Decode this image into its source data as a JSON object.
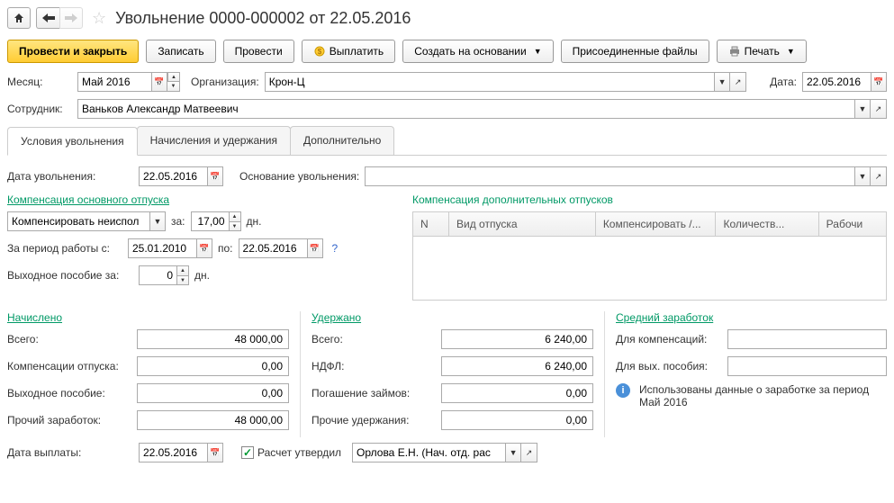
{
  "header": {
    "title": "Увольнение 0000-000002 от 22.05.2016"
  },
  "toolbar": {
    "post_close": "Провести и закрыть",
    "save": "Записать",
    "post": "Провести",
    "pay": "Выплатить",
    "create_based": "Создать на основании",
    "attached": "Присоединенные файлы",
    "print": "Печать"
  },
  "form": {
    "month_label": "Месяц:",
    "month_value": "Май 2016",
    "org_label": "Организация:",
    "org_value": "Крон-Ц",
    "date_label": "Дата:",
    "date_value": "22.05.2016",
    "employee_label": "Сотрудник:",
    "employee_value": "Ваньков Александр Матвеевич"
  },
  "tabs": {
    "t1": "Условия увольнения",
    "t2": "Начисления и удержания",
    "t3": "Дополнительно"
  },
  "dismissal": {
    "date_label": "Дата увольнения:",
    "date_value": "22.05.2016",
    "reason_label": "Основание увольнения:",
    "reason_value": ""
  },
  "comp_main": {
    "title": "Компенсация основного отпуска",
    "mode": "Компенсировать неиспол",
    "za": "за:",
    "days": "17,00",
    "dn": "дн.",
    "period_label": "За период работы с:",
    "period_from": "25.01.2010",
    "po": "по:",
    "period_to": "22.05.2016",
    "severance_label": "Выходное пособие за:",
    "severance_days": "0"
  },
  "comp_extra": {
    "title": "Компенсация дополнительных отпусков",
    "cols": {
      "n": "N",
      "type": "Вид отпуска",
      "comp": "Компенсировать /...",
      "qty": "Количеств...",
      "work": "Рабочи"
    }
  },
  "accrued": {
    "title": "Начислено",
    "total_l": "Всего:",
    "total_v": "48 000,00",
    "comp_l": "Компенсации отпуска:",
    "comp_v": "0,00",
    "sev_l": "Выходное пособие:",
    "sev_v": "0,00",
    "other_l": "Прочий заработок:",
    "other_v": "48 000,00"
  },
  "withheld": {
    "title": "Удержано",
    "total_l": "Всего:",
    "total_v": "6 240,00",
    "ndfl_l": "НДФЛ:",
    "ndfl_v": "6 240,00",
    "loan_l": "Погашение займов:",
    "loan_v": "0,00",
    "other_l": "Прочие удержания:",
    "other_v": "0,00"
  },
  "avg": {
    "title": "Средний заработок",
    "comp_l": "Для компенсаций:",
    "comp_v": "",
    "sev_l": "Для вых. пособия:",
    "sev_v": "",
    "info": "Использованы данные о заработке за период Май 2016"
  },
  "footer": {
    "paydate_l": "Дата выплаты:",
    "paydate_v": "22.05.2016",
    "approved_l": "Расчет утвердил",
    "approver": "Орлова Е.Н. (Нач. отд. рас"
  }
}
